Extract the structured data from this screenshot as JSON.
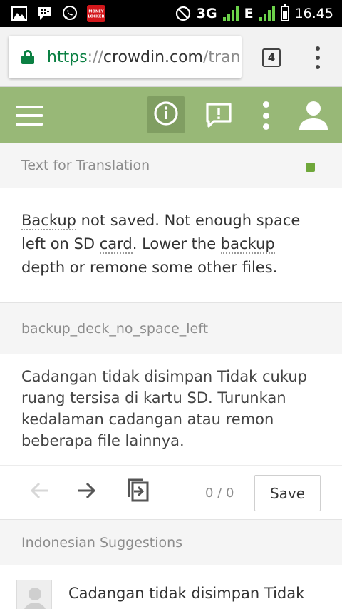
{
  "status_bar": {
    "network": "3G",
    "network2": "E",
    "time": "16.45",
    "battery_level": 0.6,
    "left_icons": [
      "image-icon",
      "bbm-icon",
      "whatsapp-icon",
      "money-locker-icon"
    ],
    "money_locker_label": "MONEY LOCKER",
    "colors": {
      "signal": "#6cd24a",
      "money_locker": "#d3171b",
      "background": "#000000"
    }
  },
  "browser": {
    "url_scheme": "https",
    "url_sep": "://",
    "url_host": "crowdin.com",
    "url_path": "/tran",
    "tab_count": "4",
    "colors": {
      "secure": "#0b8043"
    }
  },
  "toolbar": {
    "icons": [
      "menu-icon",
      "info-icon",
      "comment-alert-icon",
      "more-vert-icon",
      "person-icon"
    ],
    "active_icon": "info-icon",
    "colors": {
      "background": "#98b877",
      "active": "#809e62"
    }
  },
  "source": {
    "header": "Text for Translation",
    "status_color": "#6fa73a",
    "text_parts": [
      {
        "t": "Backup",
        "term": true
      },
      {
        "t": " not saved. Not enough space left on SD ",
        "term": false
      },
      {
        "t": "card",
        "term": true
      },
      {
        "t": ". Lower the ",
        "term": false
      },
      {
        "t": "backup",
        "term": true
      },
      {
        "t": " depth or remone some other files.",
        "term": false
      }
    ]
  },
  "string_id": "backup_deck_no_space_left",
  "translation": {
    "text": "Cadangan tidak disimpan Tidak cukup ruang tersisa di kartu SD. Turunkan kedalaman cadangan atau remon beberapa file lainnya."
  },
  "editor": {
    "counter": "0 / 0",
    "save_label": "Save"
  },
  "suggestions": {
    "header": "Indonesian Suggestions",
    "items": [
      {
        "text": "Cadangan tidak disimpan Tidak"
      }
    ]
  }
}
